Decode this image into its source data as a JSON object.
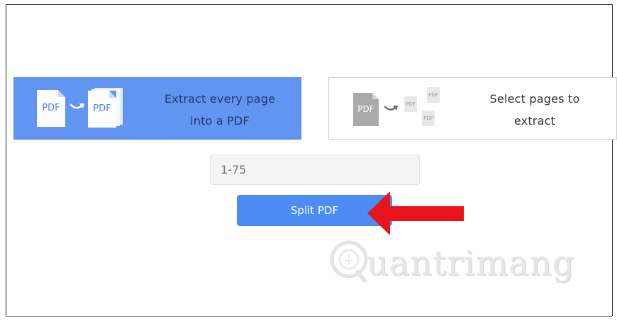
{
  "options": {
    "extract_all": {
      "label_line1": "Extract every page",
      "label_line2": "into a PDF",
      "selected": true
    },
    "select_pages": {
      "label_line1": "Select pages to",
      "label_line2": "extract",
      "selected": false
    }
  },
  "icons": {
    "pdf_source": "PDF",
    "pdf_target": "PDF",
    "pdf_gray": "PDF",
    "pdf_small": "PDF"
  },
  "range_input": {
    "placeholder": "1-75",
    "value": ""
  },
  "split_button": {
    "label": "Split PDF"
  },
  "watermark": {
    "text": "uantrimang"
  },
  "colors": {
    "selected_option_bg": "#6294f2",
    "button_bg": "#4d8cf5",
    "arrow": "#e8141b"
  }
}
